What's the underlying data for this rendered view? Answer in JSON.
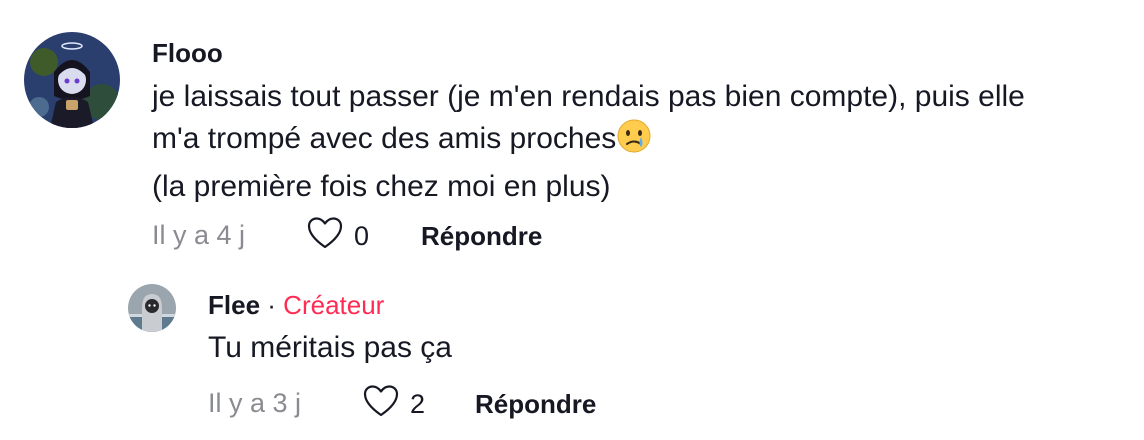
{
  "comments": [
    {
      "username": "Flooo",
      "lines": [
        "je laissais tout passer (je m'en rendais pas bien compte), puis elle",
        "m'a trompé avec des amis proches",
        "(la première fois chez moi en plus)"
      ],
      "emoji": "crying-face-emoji",
      "time": "Il y a 4 j",
      "likes": "0",
      "reply_label": "Répondre"
    },
    {
      "username": "Flee",
      "separator": "·",
      "badge": "Créateur",
      "lines": [
        "Tu méritais pas ça"
      ],
      "time": "Il y a 3 j",
      "likes": "2",
      "reply_label": "Répondre"
    }
  ],
  "colors": {
    "creator_badge": "#fe2c55",
    "muted": "#8a8b91",
    "text": "#161823"
  }
}
